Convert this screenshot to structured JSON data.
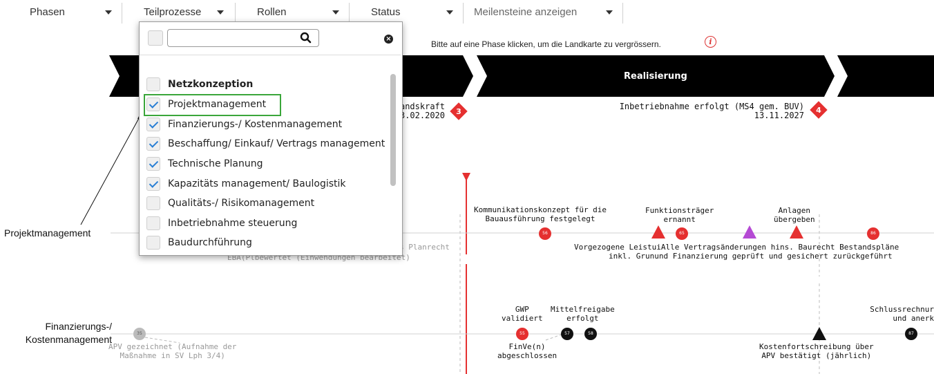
{
  "filters": [
    {
      "label": "Phasen"
    },
    {
      "label": "Teilprozesse"
    },
    {
      "label": "Rollen"
    },
    {
      "label": "Status"
    },
    {
      "label": "Meilensteine anzeigen"
    }
  ],
  "hint": "Bitte auf eine Phase klicken, um die Landkarte zu vergrössern.",
  "phases": [
    {
      "label": "Realisierung"
    }
  ],
  "milestones": [
    {
      "line1": "andskraft",
      "line2": "3.02.2020",
      "number": "3"
    },
    {
      "line1": "Inbetriebnahme erfolgt (MS4 gem. BUV)",
      "line2": "13.11.2027",
      "number": "4"
    }
  ],
  "dropdown": {
    "search_value": "",
    "items": [
      {
        "label": "Netzkonzeption",
        "checked": false,
        "group": true
      },
      {
        "label": "Projektmanagement",
        "checked": true
      },
      {
        "label": "Finanzierungs-/ Kostenmanagement",
        "checked": true
      },
      {
        "label": "Beschaffung/ Einkauf/ Vertrags management",
        "checked": true
      },
      {
        "label": "Technische Planung",
        "checked": true
      },
      {
        "label": "Kapazitäts management/ Baulogistik",
        "checked": true
      },
      {
        "label": "Qualitäts-/ Risikomanagement",
        "checked": false
      },
      {
        "label": "Inbetriebnahme steuerung",
        "checked": false
      },
      {
        "label": "Baudurchführung",
        "checked": false
      }
    ]
  },
  "annotation": {
    "label": "Projektmanagement"
  },
  "lanes": [
    {
      "title_line1": "Projektmanagement",
      "title_line2": ""
    },
    {
      "title_line1": "Finanzierungs-/",
      "title_line2": "Kostenmanagement"
    }
  ],
  "lane1_events": {
    "komm_line1": "Kommunikationskonzept für die",
    "komm_line2": "Bauausführung festgelegt",
    "komm_num": "56",
    "funk_line1": "Funktionsträger",
    "funk_line2": "ernannt",
    "funk_num": "65",
    "anl_line1": "Anlagen",
    "anl_line2": "übergeben",
    "anl_num": "74",
    "best_num": "86",
    "tri_num": "54",
    "purple_num": "71",
    "bottom_line1": "Vorgezogene LeistuiAlle Vertragsänderungen hins. Baurecht Bestandspläne",
    "bottom_line2": "inkl. Grunund Finanzierung geprüft und gesichert zurückgeführt",
    "gray_line1": "s Planrecht",
    "gray_line2": "EBA(Plbewertet (Einwendungen bearbeitet)"
  },
  "lane2_events": {
    "apv_num": "35",
    "apv_line1": "APV gezeichnet (Aufnahme der",
    "apv_line2": "Maßnahme in SV Lph 3/4)",
    "gwp_line1": "GWP",
    "gwp_line2": "validiert",
    "gwp_num": "55",
    "finve_line1": "FinVe(n)",
    "finve_line2": "abgeschlossen",
    "mit_line1": "Mittelfreigabe",
    "mit_line2": "erfolgt",
    "mit_num1": "57",
    "mit_num2": "58",
    "kfs_line1": "Kostenfortschreibung über",
    "kfs_line2": "APV bestätigt (jährlich)",
    "kfs_num": "68",
    "schluss_line1": "Schlussrechnur",
    "schluss_line2": "und anerk",
    "schluss_num": "87"
  },
  "colors": {
    "accent_red": "#e53030",
    "highlight_green": "#3aa63a",
    "check_blue": "#2a7fd4",
    "purple": "#b54ad4"
  }
}
